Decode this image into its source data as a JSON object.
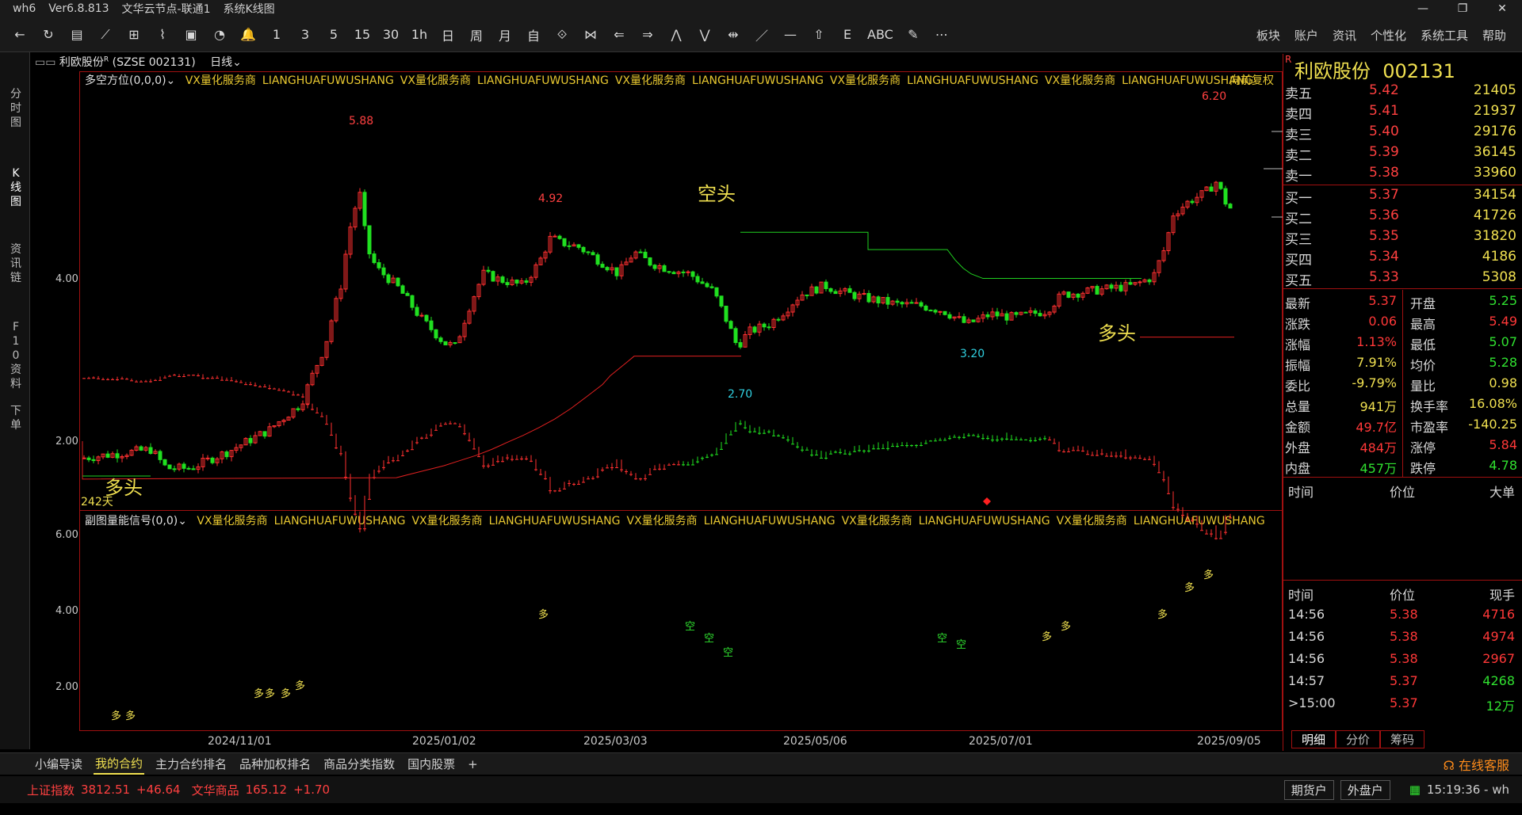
{
  "titlebar": {
    "app": "wh6",
    "version": "Ver6.8.813",
    "server": "文华云节点-联通1",
    "view": "系统K线图"
  },
  "toolbar": {
    "items": [
      "←",
      "↻",
      "▤",
      "⟋",
      "⊞",
      "⌇",
      "▣",
      "◔",
      "🔔",
      "1",
      "3",
      "5",
      "15",
      "30",
      "1h",
      "日",
      "周",
      "月",
      "自",
      "⟐",
      "⋈",
      "⇐",
      "⇒",
      "⋀",
      "⋁",
      "⇹",
      "／",
      "—",
      "⇧",
      "Ε",
      "ABC",
      "✎",
      "⋯"
    ]
  },
  "menu": [
    "板块",
    "账户",
    "资讯",
    "个性化",
    "系统工具",
    "帮助"
  ],
  "sidetabs": [
    "分时图",
    "K线图",
    "资讯链",
    "F10资料",
    "下单"
  ],
  "chart": {
    "stock_title": "利欧股份",
    "stock_tag": "R",
    "exchange_code": "(SZSE  002131)",
    "period": "日线",
    "main_indicator": "多空方位(0,0,0)",
    "vx_labels": [
      "VX量化服务商",
      "LIANGHUAFUWUSHANG",
      "VX量化服务商",
      "LIANGHUAFUWUSHANG",
      "VX量化服务商",
      "LIANGHUAFUWUSHANG",
      "VX量化服务商",
      "LIANGHUAFUWUSHANG",
      "VX量化服务商",
      "LIANGHUAFUWUSHANG"
    ],
    "adjust": "向前复权",
    "sub_indicator": "副图量能信号(0,0)",
    "days_label": "242天",
    "long_label": "多头",
    "short_label": "空头",
    "y_main": [
      "4.00",
      "2.00"
    ],
    "y_sub": [
      "6.00",
      "4.00",
      "2.00"
    ],
    "x_labels": [
      "2024/11/01",
      "2025/01/02",
      "2025/03/03",
      "2025/05/06",
      "2025/07/01",
      "2025/09/05"
    ],
    "annotations": [
      "5.88",
      "4.92",
      "2.70",
      "3.20",
      "6.20"
    ],
    "sub_long": "多",
    "sub_short": "空"
  },
  "chart_data": {
    "type": "candlestick",
    "title": "利欧股份 002131",
    "price_peaks": [
      {
        "label": "5.88",
        "value": 5.88
      },
      {
        "label": "4.92",
        "value": 4.92
      },
      {
        "label": "2.70",
        "value": 2.7
      },
      {
        "label": "3.20",
        "value": 3.2
      },
      {
        "label": "6.20",
        "value": 6.2
      }
    ],
    "ylim_main": [
      1.7,
      6.4
    ],
    "ylim_sub": [
      1.4,
      6.4
    ]
  },
  "quote": {
    "name": "利欧股份",
    "code": "002131",
    "tag": "R",
    "asks": [
      {
        "label": "卖五",
        "price": "5.42",
        "vol": "21405"
      },
      {
        "label": "卖四",
        "price": "5.41",
        "vol": "21937"
      },
      {
        "label": "卖三",
        "price": "5.40",
        "vol": "29176"
      },
      {
        "label": "卖二",
        "price": "5.39",
        "vol": "36145"
      },
      {
        "label": "卖一",
        "price": "5.38",
        "vol": "33960"
      }
    ],
    "bids": [
      {
        "label": "买一",
        "price": "5.37",
        "vol": "34154"
      },
      {
        "label": "买二",
        "price": "5.36",
        "vol": "41726"
      },
      {
        "label": "买三",
        "price": "5.35",
        "vol": "31820"
      },
      {
        "label": "买四",
        "price": "5.34",
        "vol": "4186"
      },
      {
        "label": "买五",
        "price": "5.33",
        "vol": "5308"
      }
    ],
    "stats_left": [
      {
        "label": "最新",
        "value": "5.37",
        "color": "red"
      },
      {
        "label": "涨跌",
        "value": "0.06",
        "color": "red"
      },
      {
        "label": "涨幅",
        "value": "1.13%",
        "color": "red"
      },
      {
        "label": "振幅",
        "value": "7.91%",
        "color": "yel"
      },
      {
        "label": "委比",
        "value": "-9.79%",
        "color": "yel"
      },
      {
        "label": "总量",
        "value": "941万",
        "color": "yel"
      },
      {
        "label": "金额",
        "value": "49.7亿",
        "color": "red"
      },
      {
        "label": "外盘",
        "value": "484万",
        "color": "red"
      },
      {
        "label": "内盘",
        "value": "457万",
        "color": "green"
      }
    ],
    "stats_right": [
      {
        "label": "开盘",
        "value": "5.25",
        "color": "green"
      },
      {
        "label": "最高",
        "value": "5.49",
        "color": "red"
      },
      {
        "label": "最低",
        "value": "5.07",
        "color": "green"
      },
      {
        "label": "均价",
        "value": "5.28",
        "color": "green"
      },
      {
        "label": "量比",
        "value": "0.98",
        "color": "yel"
      },
      {
        "label": "换手率",
        "value": "16.08%",
        "color": "yel"
      },
      {
        "label": "市盈率",
        "value": "-140.25",
        "color": "yel"
      },
      {
        "label": "涨停",
        "value": "5.84",
        "color": "red"
      },
      {
        "label": "跌停",
        "value": "4.78",
        "color": "green"
      }
    ],
    "big_header": {
      "time": "时间",
      "price": "价位",
      "vol": "大单"
    },
    "tick_header": {
      "time": "时间",
      "price": "价位",
      "vol": "现手"
    },
    "ticks": [
      {
        "time": "14:56",
        "price": "5.38",
        "vol": "4716",
        "vc": "red"
      },
      {
        "time": "14:56",
        "price": "5.38",
        "vol": "4974",
        "vc": "red"
      },
      {
        "time": "14:56",
        "price": "5.38",
        "vol": "2967",
        "vc": "red"
      },
      {
        "time": "14:57",
        "price": "5.37",
        "vol": "4268",
        "vc": "green"
      },
      {
        "time": ">15:00",
        "price": "5.37",
        "vol": "12万",
        "vc": "green"
      }
    ],
    "tabs": [
      "明细",
      "分价",
      "筹码"
    ]
  },
  "bottomtabs": [
    "小编导读",
    "我的合约",
    "主力合约排名",
    "品种加权排名",
    "商品分类指数",
    "国内股票",
    "+"
  ],
  "bottom_active": "我的合约",
  "service": "在线客服",
  "status": {
    "idx1_name": "上证指数",
    "idx1_val": "3812.51",
    "idx1_chg": "+46.64",
    "idx2_name": "文华商品",
    "idx2_val": "165.12",
    "idx2_chg": "+1.70",
    "btn1": "期货户",
    "btn2": "外盘户",
    "time": "15:19:36 - wh"
  },
  "colors": {
    "up": "#ff3030",
    "down": "#20e020",
    "accent": "#f0e050",
    "border": "#a01010"
  }
}
